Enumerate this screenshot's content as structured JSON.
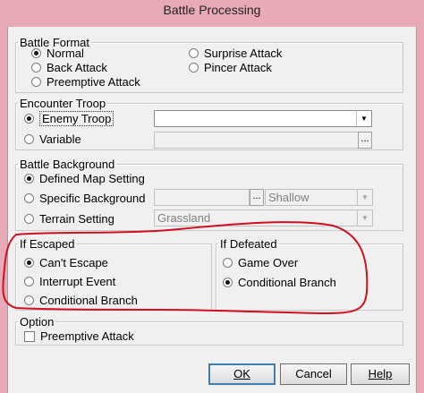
{
  "window": {
    "title": "Battle Processing"
  },
  "battle_format": {
    "legend": "Battle Format",
    "options": [
      "Normal",
      "Back Attack",
      "Preemptive Attack",
      "Surprise Attack",
      "Pincer Attack"
    ],
    "selected": "Normal"
  },
  "encounter_troop": {
    "legend": "Encounter Troop",
    "options": [
      "Enemy Troop",
      "Variable"
    ],
    "selected": "Enemy Troop",
    "troop_value": "",
    "variable_value": "",
    "ellipsis": "..."
  },
  "battle_background": {
    "legend": "Battle Background",
    "options": [
      "Defined Map Setting",
      "Specific Background",
      "Terrain Setting"
    ],
    "selected": "Defined Map Setting",
    "specific_value": "",
    "ellipsis": "...",
    "shallow_value": "Shallow",
    "terrain_value": "Grassland"
  },
  "if_escaped": {
    "legend": "If Escaped",
    "options": [
      "Can't Escape",
      "Interrupt Event",
      "Conditional Branch"
    ],
    "selected": "Can't Escape"
  },
  "if_defeated": {
    "legend": "If Defeated",
    "options": [
      "Game Over",
      "Conditional Branch"
    ],
    "selected": "Conditional Branch"
  },
  "option": {
    "legend": "Option",
    "checkbox_label": "Preemptive Attack",
    "checked": false
  },
  "buttons": {
    "ok": "OK",
    "cancel": "Cancel",
    "help": "Help"
  },
  "annotation": {
    "color": "#d01020"
  }
}
